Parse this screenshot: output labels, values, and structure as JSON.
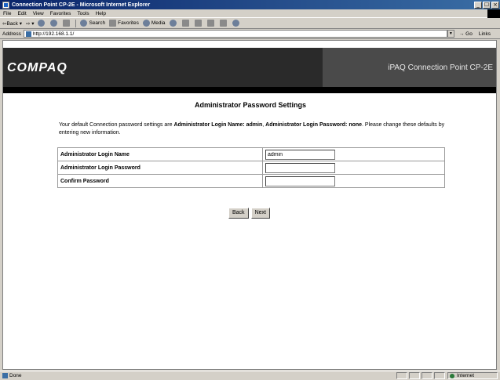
{
  "window": {
    "title": "Connection Point CP-2E  - Microsoft Internet Explorer",
    "buttons": [
      "_",
      "☐",
      "×"
    ]
  },
  "menu": [
    "File",
    "Edit",
    "View",
    "Favorites",
    "Tools",
    "Help"
  ],
  "toolbar": {
    "back_label": "⇦Back ▾",
    "forward_label": "⇨ ▾",
    "search_label": "Search",
    "favorites_label": "Favorites",
    "media_label": "Media"
  },
  "address_bar": {
    "label": "Address",
    "url": "http://192.168.1.1/",
    "go_label": "Go",
    "links_label": "Links"
  },
  "page": {
    "brand": "COMPAQ",
    "product": "iPAQ Connection Point CP-2E",
    "heading": "Administrator Password Settings",
    "intro_text_1": "Your default Connection password settings are ",
    "intro_bold_1": "Administrator Login Name: admin",
    "intro_text_2": ", ",
    "intro_bold_2": "Administrator Login Password: none",
    "intro_text_3": ". Please change these defaults by entering new information.",
    "fields": [
      {
        "label": "Administrator Login Name",
        "value": "admin"
      },
      {
        "label": "Administrator Login Password",
        "value": ""
      },
      {
        "label": "Confirm Password",
        "value": ""
      }
    ],
    "back_button": "Back",
    "next_button": "Next"
  },
  "status_bar": {
    "text": "Done",
    "zone": "Internet"
  }
}
